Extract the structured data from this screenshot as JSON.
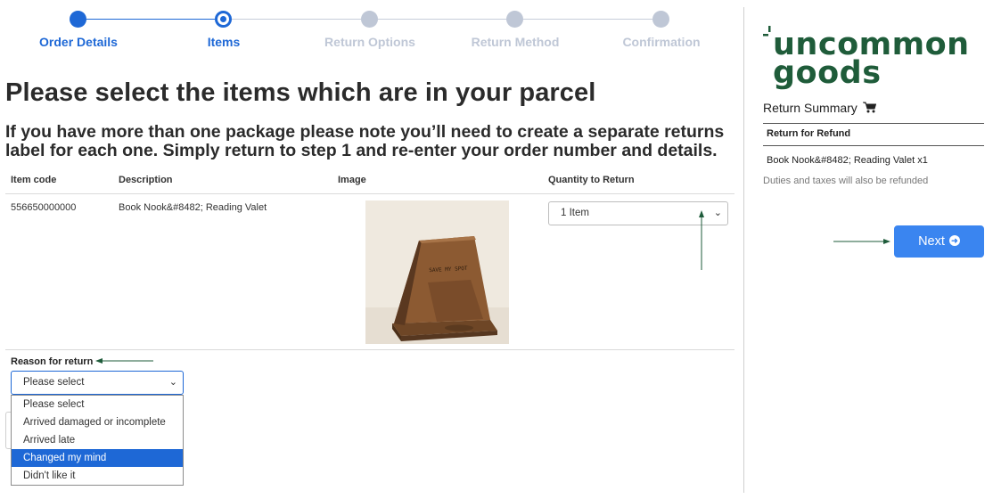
{
  "stepper": {
    "steps": [
      {
        "label": "Order Details",
        "state": "done"
      },
      {
        "label": "Items",
        "state": "current"
      },
      {
        "label": "Return Options",
        "state": "todo"
      },
      {
        "label": "Return Method",
        "state": "todo"
      },
      {
        "label": "Confirmation",
        "state": "todo"
      }
    ]
  },
  "main": {
    "title": "Please select the items which are in your parcel",
    "subtitle": "If you have more than one package please note you’ll need to create a separate returns label for each one. Simply return to step 1 and re-enter your order number and details.",
    "table": {
      "headers": [
        "Item code",
        "Description",
        "Image",
        "Quantity to Return"
      ],
      "row": {
        "item_code": "556650000000",
        "description": "Book Nook&#8482; Reading Valet",
        "image_text": "SAVE MY SPOT",
        "quantity": "1 Item"
      }
    },
    "reason": {
      "label": "Reason for return",
      "selected": "Please select",
      "options": [
        "Please select",
        "Arrived damaged or incomplete",
        "Arrived late",
        "Changed my mind",
        "Didn't like it"
      ],
      "highlighted": "Changed my mind"
    }
  },
  "sidebar": {
    "logo_line1": "uncommon",
    "logo_line2": "goods",
    "summary_title": "Return Summary",
    "section_heading": "Return for Refund",
    "item_line": "Book Nook&#8482; Reading Valet x1",
    "note": "Duties and taxes will also be refunded",
    "next_label": "Next"
  },
  "colors": {
    "accent": "#1e68d6",
    "button": "#3a85f0",
    "brand": "#1f5c3a",
    "arrow": "#1e5b3a"
  }
}
